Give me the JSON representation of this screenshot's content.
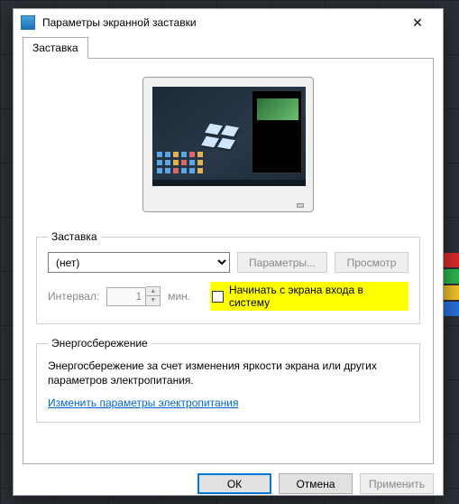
{
  "window": {
    "title": "Параметры экранной заставки"
  },
  "tab": {
    "label": "Заставка"
  },
  "screensaver": {
    "legend": "Заставка",
    "selected": "(нет)",
    "settings_btn": "Параметры...",
    "preview_btn": "Просмотр",
    "interval_label": "Интервал:",
    "interval_value": "1",
    "interval_unit": "мин.",
    "resume_checkbox_label": "Начинать с экрана входа в систему",
    "resume_checked": false
  },
  "power": {
    "legend": "Энергосбережение",
    "text": "Энергосбережение за счет изменения яркости экрана или других параметров электропитания.",
    "link": "Изменить параметры электропитания"
  },
  "buttons": {
    "ok": "ОК",
    "cancel": "Отмена",
    "apply": "Применить"
  }
}
